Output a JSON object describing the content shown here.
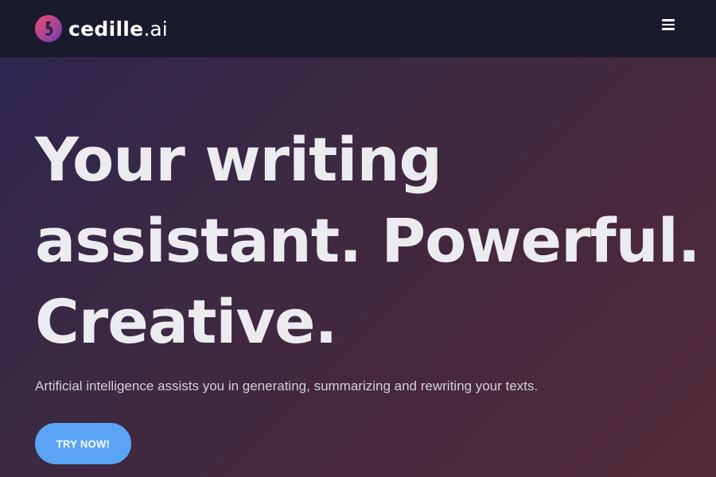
{
  "header": {
    "brand_name": "cedille",
    "brand_suffix": ".ai",
    "logo_icon": "cedille-logo-icon",
    "menu_icon": "hamburger-menu-icon"
  },
  "hero": {
    "headline": "Your writing assistant. Powerful. Creative.",
    "subtitle": "Artificial intelligence assists you in generating, summarizing and rewriting your texts.",
    "cta_label": "TRY NOW!"
  },
  "colors": {
    "navbar_bg": "#1a1a2f",
    "cta_bg": "#5ba4f5",
    "logo_gradient_start": "#e8485f",
    "logo_gradient_end": "#7a3db5"
  }
}
